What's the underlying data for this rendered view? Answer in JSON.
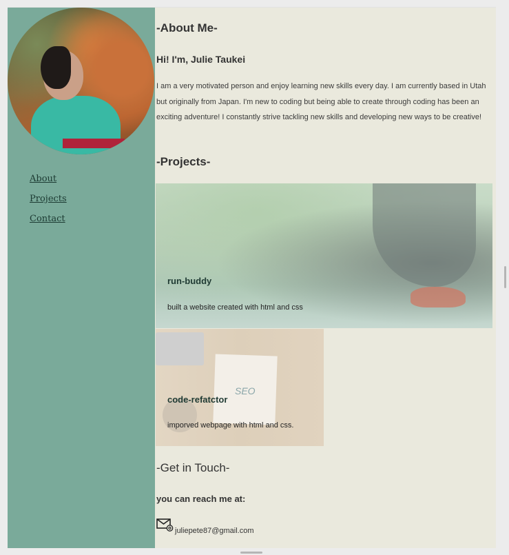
{
  "nav": {
    "items": [
      "About",
      "Projects",
      "Contact"
    ]
  },
  "about": {
    "heading": "-About Me-",
    "greeting": "Hi! I'm, Julie Taukei",
    "bio": "I am a very motivated person and enjoy learning new skills every day. I am currently based in Utah but originally from Japan. I'm new to coding but being able to create through coding has been an exciting adventure! I constantly strive tackling new skills and developing new ways to be creative!"
  },
  "projects": {
    "heading": "-Projects-",
    "items": [
      {
        "title": "run-buddy",
        "description": "built a website created with html and css"
      },
      {
        "title": "code-refatctor",
        "description": "imporved webpage with html and css."
      }
    ],
    "image_text": {
      "seo": "SEO"
    }
  },
  "contact": {
    "heading": "-Get in Touch-",
    "reach": "you can reach me at:",
    "email": "juliepete87@gmail.com",
    "icon": "email-icon"
  },
  "colors": {
    "sidebar": "#7aaa9a",
    "content_bg": "#eae9dd",
    "nav_link": "#1c3a32",
    "heading_text": "#333333"
  }
}
